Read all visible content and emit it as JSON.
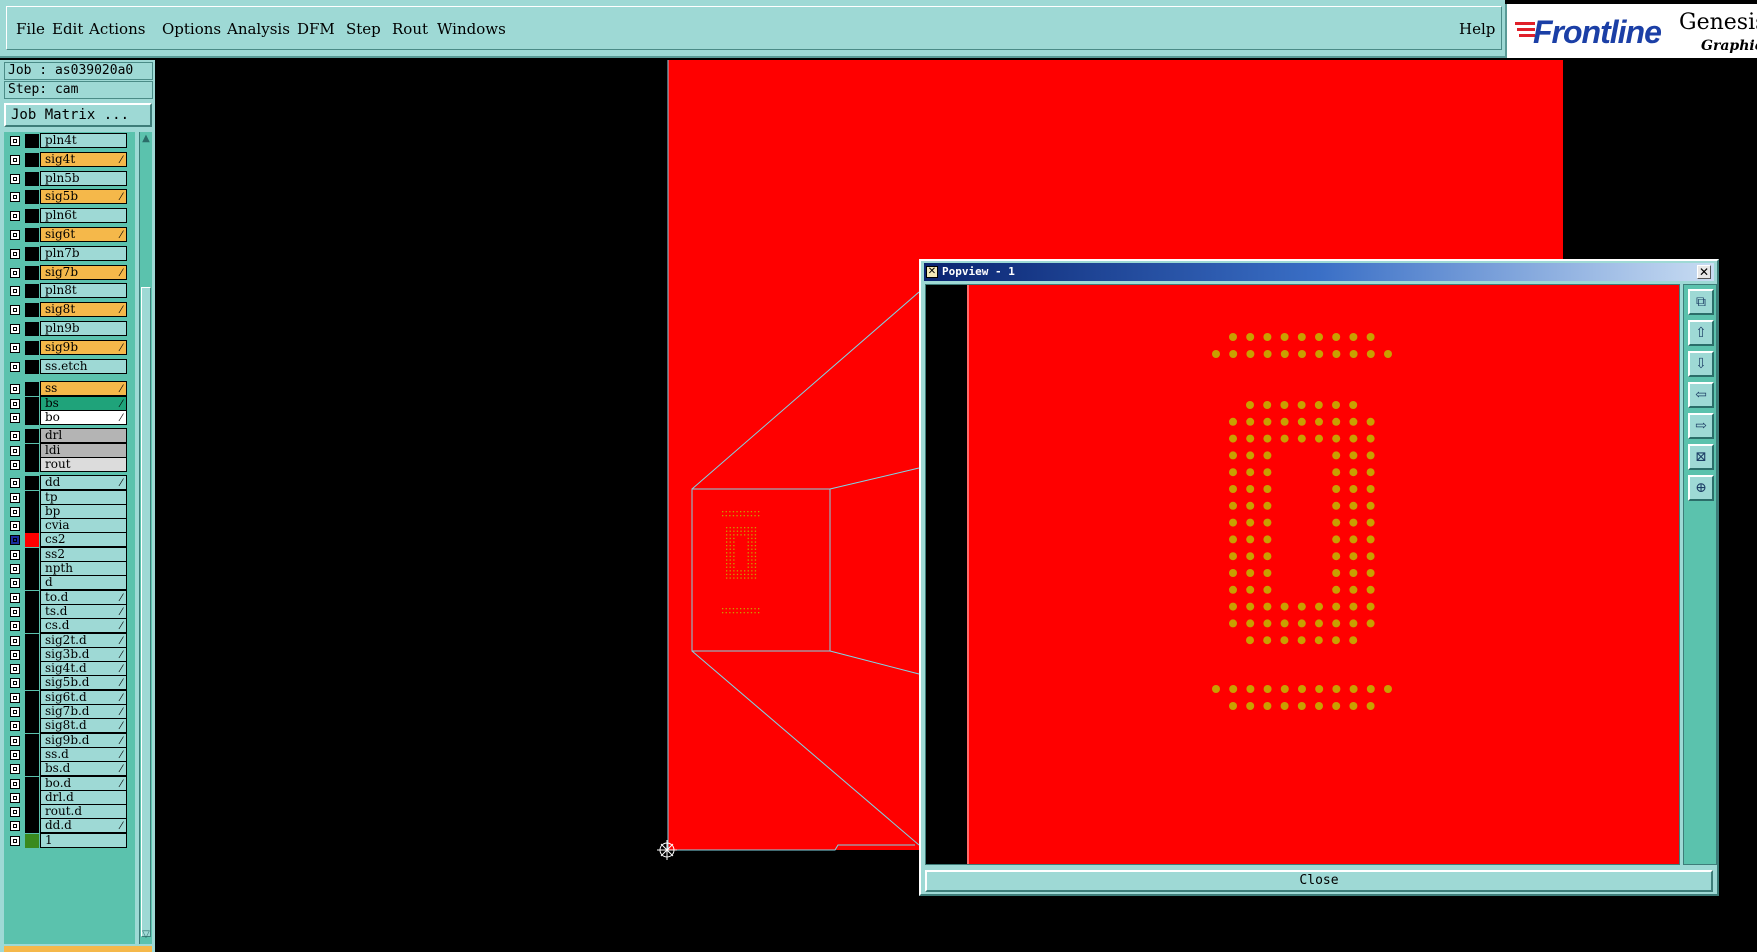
{
  "menubar": {
    "items": [
      "File",
      "Edit",
      "Actions",
      "Options",
      "Analysis",
      "DFM",
      "Step",
      "Rout",
      "Windows"
    ],
    "help": "Help"
  },
  "brand": {
    "logo": "Frontline",
    "product": "Genesis",
    "subtitle": "Graphic E",
    "logo_color": "#1b3fa6"
  },
  "job": {
    "job_label": "Job : as039020a0",
    "step_label": "Step: cam",
    "matrix_button": "Job Matrix ..."
  },
  "layers": [
    {
      "name": "pln4t",
      "color": "#9ed9d5",
      "swatch": "#000000",
      "edit": false
    },
    {
      "name": "sig4t",
      "color": "#f5b84a",
      "swatch": "#000000",
      "edit": true
    },
    {
      "name": "pln5b",
      "color": "#9ed9d5",
      "swatch": "#000000",
      "edit": false
    },
    {
      "name": "sig5b",
      "color": "#f5b84a",
      "swatch": "#000000",
      "edit": true
    },
    {
      "name": "pln6t",
      "color": "#9ed9d5",
      "swatch": "#000000",
      "edit": false
    },
    {
      "name": "sig6t",
      "color": "#f5b84a",
      "swatch": "#000000",
      "edit": true
    },
    {
      "name": "pln7b",
      "color": "#9ed9d5",
      "swatch": "#000000",
      "edit": false
    },
    {
      "name": "sig7b",
      "color": "#f5b84a",
      "swatch": "#000000",
      "edit": true
    },
    {
      "name": "pln8t",
      "color": "#9ed9d5",
      "swatch": "#000000",
      "edit": false
    },
    {
      "name": "sig8t",
      "color": "#f5b84a",
      "swatch": "#000000",
      "edit": true
    },
    {
      "name": "pln9b",
      "color": "#9ed9d5",
      "swatch": "#000000",
      "edit": false
    },
    {
      "name": "sig9b",
      "color": "#f5b84a",
      "swatch": "#000000",
      "edit": true
    },
    {
      "name": "ss.etch",
      "color": "#9ed9d5",
      "swatch": "#000000",
      "edit": false
    },
    {
      "name": "ss",
      "color": "#f5b84a",
      "swatch": "#000000",
      "edit": true
    },
    {
      "name": "bs",
      "color": "#1fa37a",
      "swatch": "#000000",
      "edit": true
    },
    {
      "name": "bo",
      "color": "#ffffff",
      "swatch": "#000000",
      "edit": true
    },
    {
      "name": "drl",
      "color": "#b4b4b4",
      "swatch": "#000000",
      "edit": false
    },
    {
      "name": "ldi",
      "color": "#b4b4b4",
      "swatch": "#000000",
      "edit": false
    },
    {
      "name": "rout",
      "color": "#dcdcdc",
      "swatch": "#000000",
      "edit": false
    },
    {
      "name": "dd",
      "color": "#9ed9d5",
      "swatch": "#000000",
      "edit": true
    },
    {
      "name": "tp",
      "color": "#9ed9d5",
      "swatch": "#000000",
      "edit": false
    },
    {
      "name": "bp",
      "color": "#9ed9d5",
      "swatch": "#000000",
      "edit": false
    },
    {
      "name": "cvia",
      "color": "#9ed9d5",
      "swatch": "#000000",
      "edit": false
    },
    {
      "name": "cs2",
      "color": "#9ed9d5",
      "swatch": "#ff0000",
      "edit": false,
      "active": true
    },
    {
      "name": "ss2",
      "color": "#9ed9d5",
      "swatch": "#000000",
      "edit": false
    },
    {
      "name": "npth",
      "color": "#9ed9d5",
      "swatch": "#000000",
      "edit": false
    },
    {
      "name": "d",
      "color": "#9ed9d5",
      "swatch": "#000000",
      "edit": false
    },
    {
      "name": "to.d",
      "color": "#9ed9d5",
      "swatch": "#000000",
      "edit": true
    },
    {
      "name": "ts.d",
      "color": "#9ed9d5",
      "swatch": "#000000",
      "edit": true
    },
    {
      "name": "cs.d",
      "color": "#9ed9d5",
      "swatch": "#000000",
      "edit": true
    },
    {
      "name": "sig2t.d",
      "color": "#9ed9d5",
      "swatch": "#000000",
      "edit": true
    },
    {
      "name": "sig3b.d",
      "color": "#9ed9d5",
      "swatch": "#000000",
      "edit": true
    },
    {
      "name": "sig4t.d",
      "color": "#9ed9d5",
      "swatch": "#000000",
      "edit": true
    },
    {
      "name": "sig5b.d",
      "color": "#9ed9d5",
      "swatch": "#000000",
      "edit": true
    },
    {
      "name": "sig6t.d",
      "color": "#9ed9d5",
      "swatch": "#000000",
      "edit": true
    },
    {
      "name": "sig7b.d",
      "color": "#9ed9d5",
      "swatch": "#000000",
      "edit": true
    },
    {
      "name": "sig8t.d",
      "color": "#9ed9d5",
      "swatch": "#000000",
      "edit": true
    },
    {
      "name": "sig9b.d",
      "color": "#9ed9d5",
      "swatch": "#000000",
      "edit": true
    },
    {
      "name": "ss.d",
      "color": "#9ed9d5",
      "swatch": "#000000",
      "edit": true
    },
    {
      "name": "bs.d",
      "color": "#9ed9d5",
      "swatch": "#000000",
      "edit": true
    },
    {
      "name": "bo.d",
      "color": "#9ed9d5",
      "swatch": "#000000",
      "edit": true
    },
    {
      "name": "drl.d",
      "color": "#9ed9d5",
      "swatch": "#000000",
      "edit": false
    },
    {
      "name": "rout.d",
      "color": "#9ed9d5",
      "swatch": "#000000",
      "edit": false
    },
    {
      "name": "dd.d",
      "color": "#9ed9d5",
      "swatch": "#000000",
      "edit": true
    },
    {
      "name": "1",
      "color": "#9ed9d5",
      "swatch": "#3a8a1e",
      "edit": false
    }
  ],
  "popview": {
    "title": "Popview - 1",
    "close_label": "Close",
    "tools": [
      "zoom-window-icon",
      "pan-up-icon",
      "pan-down-icon",
      "pan-left-icon",
      "pan-right-icon",
      "zoom-home-icon",
      "fit-icon"
    ]
  },
  "colors": {
    "board": "#ff0000",
    "pad": "#c8a000",
    "outline": "#7fd6e6",
    "panel": "#9ed9d5"
  }
}
